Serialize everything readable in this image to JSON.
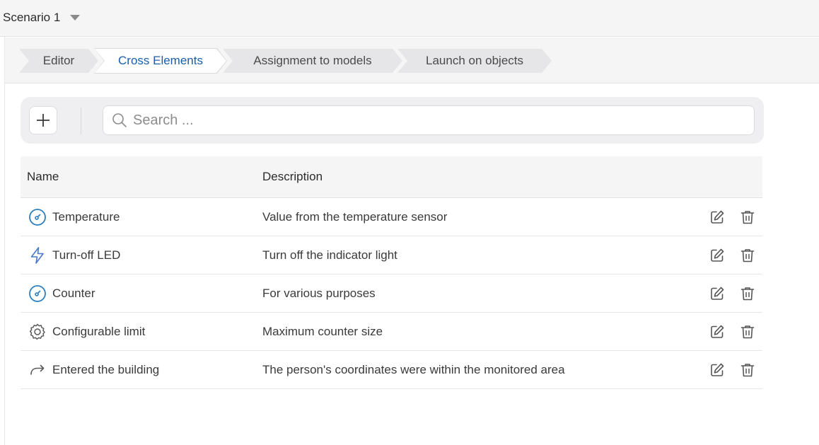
{
  "header": {
    "scenario_title": "Scenario 1"
  },
  "tabs": [
    {
      "label": "Editor",
      "active": false
    },
    {
      "label": "Cross Elements",
      "active": true
    },
    {
      "label": "Assignment to models",
      "active": false
    },
    {
      "label": "Launch on objects",
      "active": false
    }
  ],
  "toolbar": {
    "search_placeholder": "Search ..."
  },
  "table": {
    "columns": {
      "name": "Name",
      "description": "Description"
    },
    "rows": [
      {
        "icon": "gauge-icon",
        "name": "Temperature",
        "description": "Value from the temperature sensor"
      },
      {
        "icon": "lightning-icon",
        "name": "Turn-off LED",
        "description": "Turn off the indicator light"
      },
      {
        "icon": "gauge-icon",
        "name": "Counter",
        "description": "For various purposes"
      },
      {
        "icon": "gear-icon",
        "name": "Configurable limit",
        "description": "Maximum counter size"
      },
      {
        "icon": "redirect-arrow-icon",
        "name": "Entered the building",
        "description": "The person's coordinates were within the monitored area"
      }
    ]
  },
  "colors": {
    "accent": "#1a5fa8",
    "icon_blue": "#2a7fc1"
  }
}
